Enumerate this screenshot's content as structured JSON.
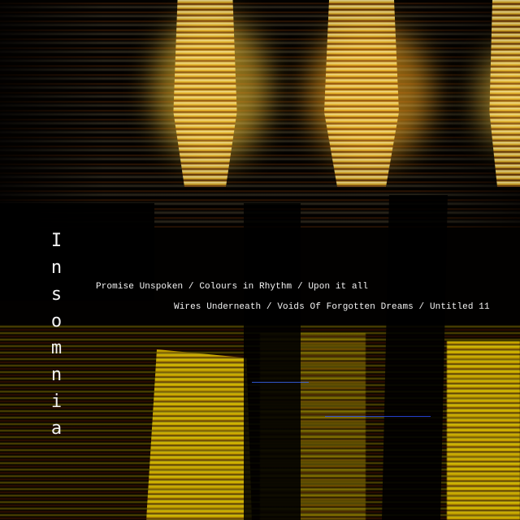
{
  "album": {
    "title": "Insomnia",
    "tracklist_line_1": "Promise Unspoken / Colours in Rhythm / Upon it all",
    "tracklist_line_2": "Wires Underneath / Voids Of Forgotten Dreams / Untitled 11"
  },
  "colors": {
    "background": "#000000",
    "highlight": "#ffcc33",
    "accent": "#ff7a1a",
    "text": "#f2f2f2"
  }
}
